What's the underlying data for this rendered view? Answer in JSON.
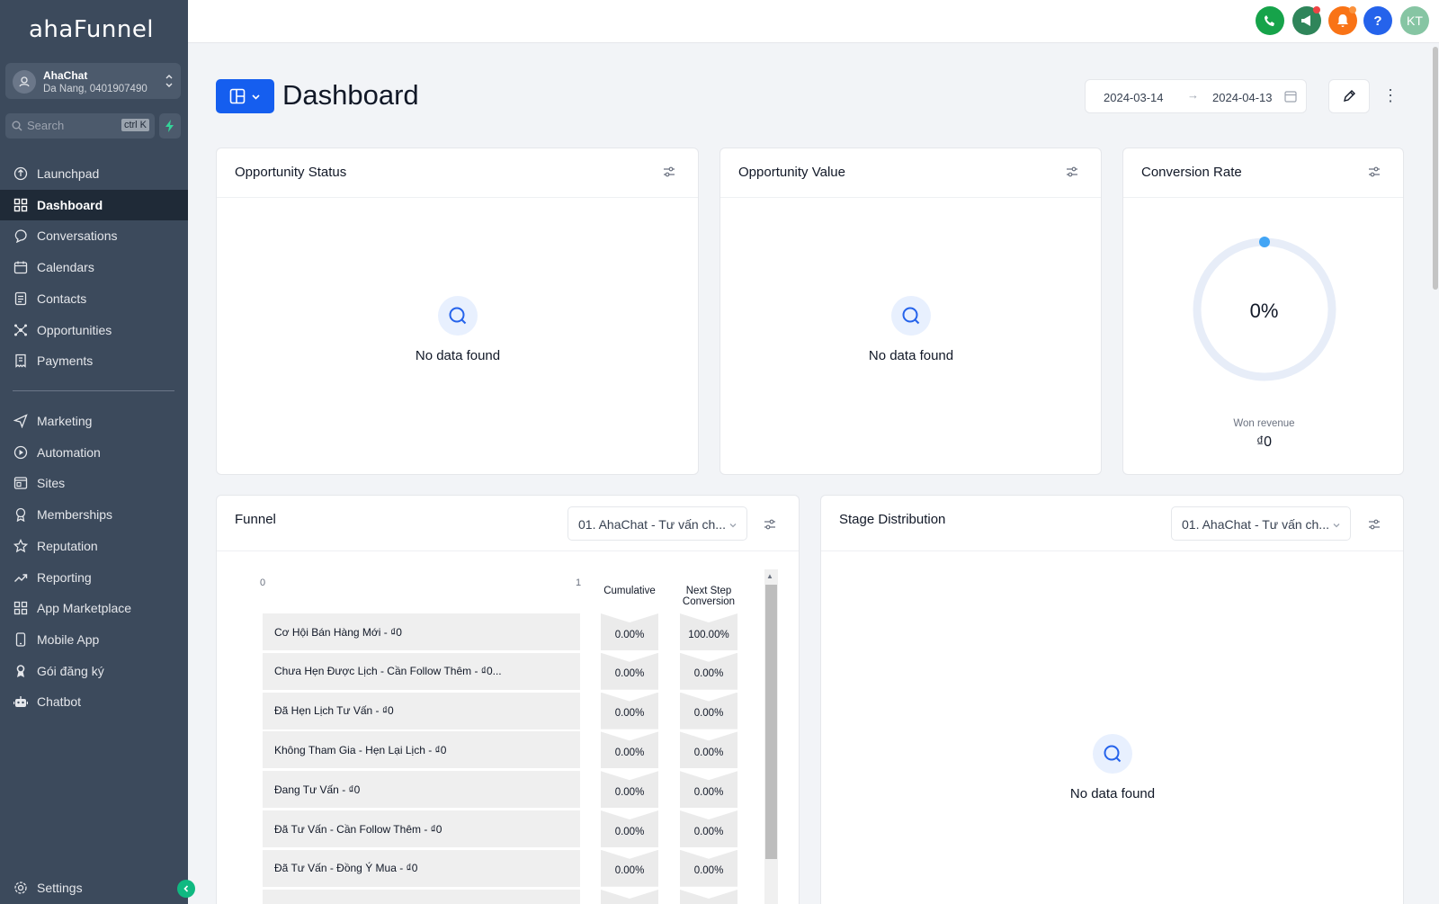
{
  "app": {
    "logo": "ahaFunnel"
  },
  "account": {
    "name": "AhaChat",
    "subtitle": "Da Nang, 0401907490"
  },
  "search": {
    "placeholder": "Search",
    "shortcut": "ctrl K"
  },
  "sidebar": {
    "items": [
      {
        "label": "Launchpad",
        "icon": "rocket-icon"
      },
      {
        "label": "Dashboard",
        "icon": "grid-icon",
        "active": true
      },
      {
        "label": "Conversations",
        "icon": "chat-icon"
      },
      {
        "label": "Calendars",
        "icon": "calendar-icon"
      },
      {
        "label": "Contacts",
        "icon": "contacts-icon"
      },
      {
        "label": "Opportunities",
        "icon": "opportunities-icon"
      },
      {
        "label": "Payments",
        "icon": "receipt-icon"
      }
    ],
    "items2": [
      {
        "label": "Marketing",
        "icon": "send-icon"
      },
      {
        "label": "Automation",
        "icon": "automation-icon"
      },
      {
        "label": "Sites",
        "icon": "sites-icon"
      },
      {
        "label": "Memberships",
        "icon": "badge-icon"
      },
      {
        "label": "Reputation",
        "icon": "star-icon"
      },
      {
        "label": "Reporting",
        "icon": "trend-icon"
      },
      {
        "label": "App Marketplace",
        "icon": "apps-icon"
      },
      {
        "label": "Mobile App",
        "icon": "mobile-icon"
      },
      {
        "label": "Gói đăng ký",
        "icon": "subscription-icon"
      },
      {
        "label": "Chatbot",
        "icon": "robot-icon"
      }
    ],
    "settings": "Settings"
  },
  "topbar": {
    "avatar": "KT",
    "help": "?"
  },
  "header": {
    "title": "Dashboard",
    "date_from": "2024-03-14",
    "date_to": "2024-04-13"
  },
  "cards": {
    "opportunity_status": {
      "title": "Opportunity Status",
      "empty": "No data found"
    },
    "opportunity_value": {
      "title": "Opportunity Value",
      "empty": "No data found"
    },
    "conversion_rate": {
      "title": "Conversion Rate",
      "value": "0%",
      "won_label": "Won revenue",
      "won_value": "₫0"
    },
    "funnel": {
      "title": "Funnel",
      "pipeline": "01. AhaChat - Tư vấn ch...",
      "axis_min": "0",
      "axis_max": "1",
      "col_cumulative": "Cumulative",
      "col_next": "Next Step Conversion"
    },
    "stage_distribution": {
      "title": "Stage Distribution",
      "pipeline": "01. AhaChat - Tư vấn ch...",
      "empty": "No data found"
    }
  },
  "funnel_rows": [
    {
      "stage": "Cơ Hội Bán Hàng Mới - ₫0",
      "cumulative": "0.00%",
      "next": "100.00%"
    },
    {
      "stage": "Chưa Hẹn Được Lịch - Cần Follow Thêm - ₫0...",
      "cumulative": "0.00%",
      "next": "0.00%"
    },
    {
      "stage": "Đã Hẹn Lịch Tư Vấn - ₫0",
      "cumulative": "0.00%",
      "next": "0.00%"
    },
    {
      "stage": "Không Tham Gia - Hẹn Lại Lịch - ₫0",
      "cumulative": "0.00%",
      "next": "0.00%"
    },
    {
      "stage": "Đang Tư Vấn - ₫0",
      "cumulative": "0.00%",
      "next": "0.00%"
    },
    {
      "stage": "Đã Tư Vấn - Cần Follow Thêm - ₫0",
      "cumulative": "0.00%",
      "next": "0.00%"
    },
    {
      "stage": "Đã Tư Vấn - Đồng Ý Mua - ₫0",
      "cumulative": "0.00%",
      "next": "0.00%"
    }
  ],
  "colors": {
    "sidebar": "#3c4a5c",
    "active": "#1f2a37",
    "primary": "#155eef",
    "ring": "#e7edf8",
    "ring_dot": "#42a5f5"
  }
}
